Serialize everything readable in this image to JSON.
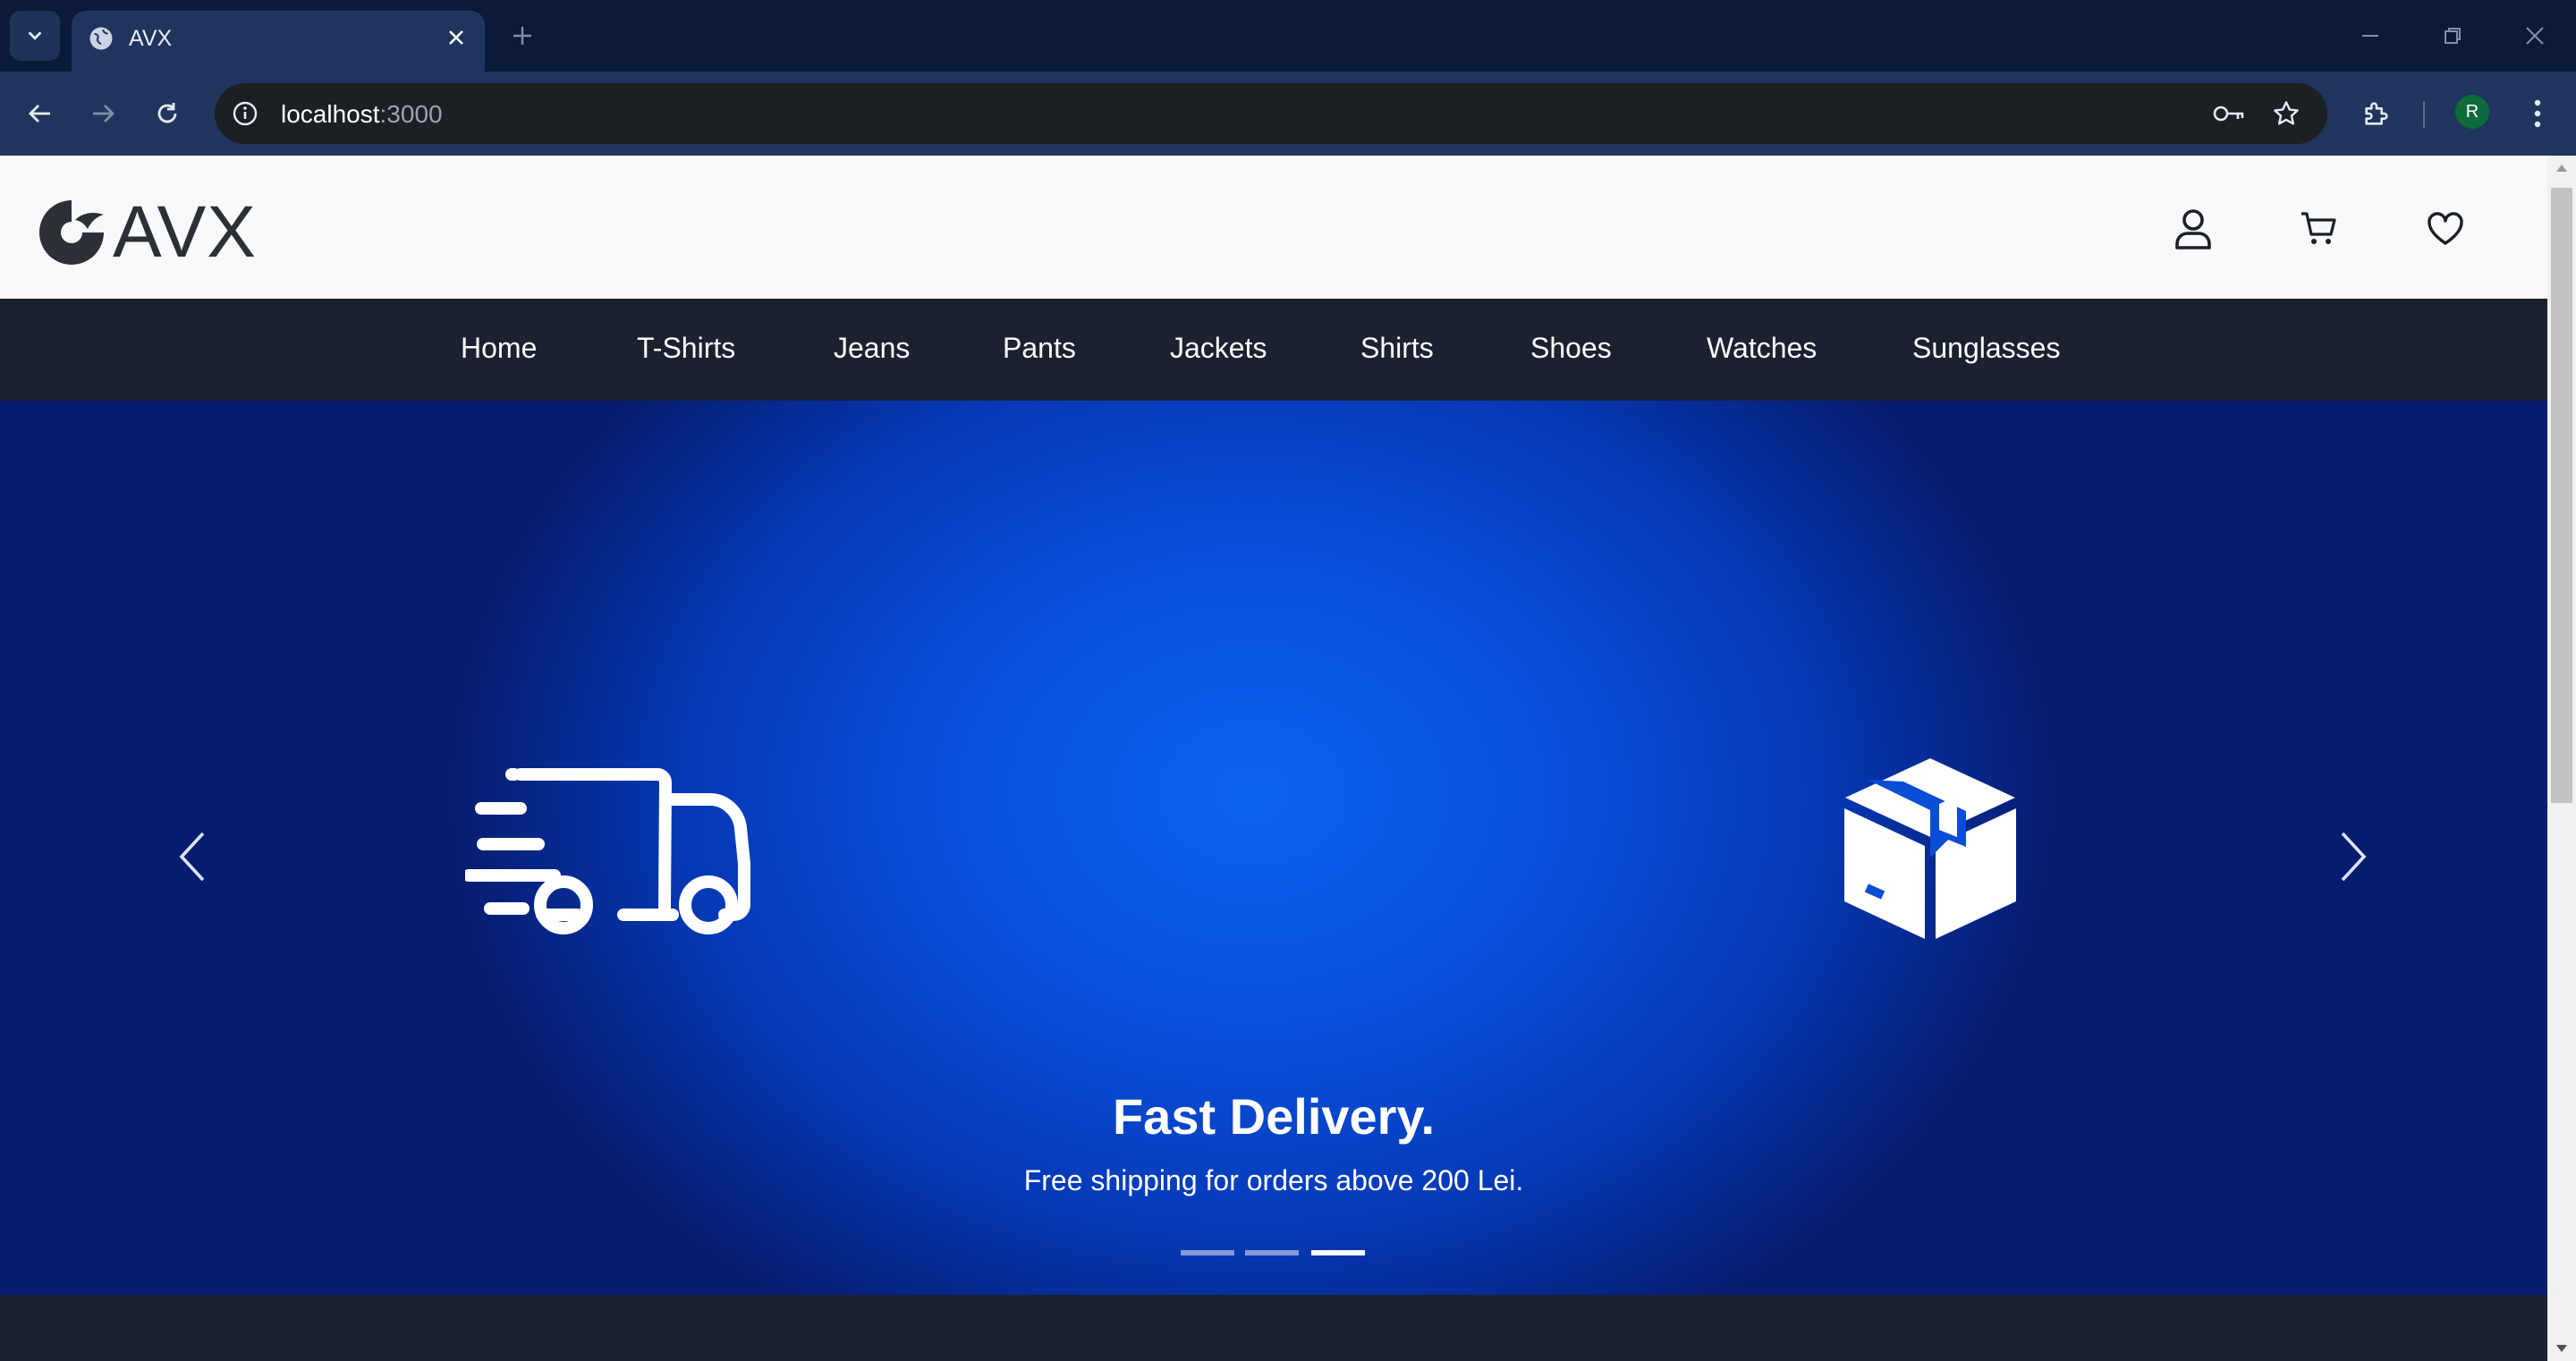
{
  "browser": {
    "tab_title": "AVX",
    "url_host": "localhost",
    "url_port": ":3000",
    "profile_initial": "R"
  },
  "site": {
    "logo_text": "AVX",
    "nav": [
      "Home",
      "T-Shirts",
      "Jeans",
      "Pants",
      "Jackets",
      "Shirts",
      "Shoes",
      "Watches",
      "Sunglasses"
    ]
  },
  "hero": {
    "title": "Fast Delivery.",
    "subtitle": "Free shipping for orders above 200 Lei.",
    "slide_count": 3,
    "active_slide": 3
  },
  "colors": {
    "chrome_tabbar": "#0b1a38",
    "chrome_toolbar": "#1f355d",
    "nav_bg": "#1c2130",
    "hero_center": "#0a63f0",
    "hero_edge": "#071c6e"
  },
  "icons": [
    "tab-search-icon",
    "globe-icon",
    "close-icon",
    "plus-icon",
    "minimize-icon",
    "restore-icon",
    "back-icon",
    "forward-icon",
    "reload-icon",
    "info-icon",
    "key-icon",
    "star-icon",
    "extensions-icon",
    "kebab-menu-icon",
    "user-icon",
    "cart-icon",
    "heart-icon",
    "truck-icon",
    "package-icon",
    "chevron-left-icon",
    "chevron-right-icon"
  ]
}
